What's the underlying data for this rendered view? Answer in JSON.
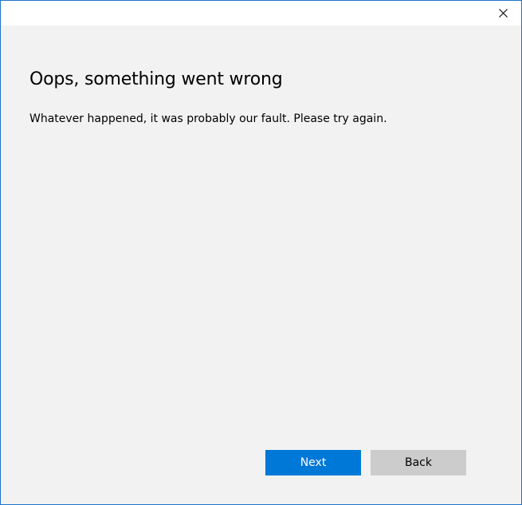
{
  "window": {
    "close_icon": "close-icon"
  },
  "main": {
    "heading": "Oops, something went wrong",
    "message": "Whatever happened, it was probably our fault. Please try again."
  },
  "buttons": {
    "next_label": "Next",
    "back_label": "Back"
  },
  "colors": {
    "accent": "#0078d7",
    "window_border": "#1e73c8",
    "background": "#f2f2f2",
    "secondary_button": "#cccccc"
  }
}
